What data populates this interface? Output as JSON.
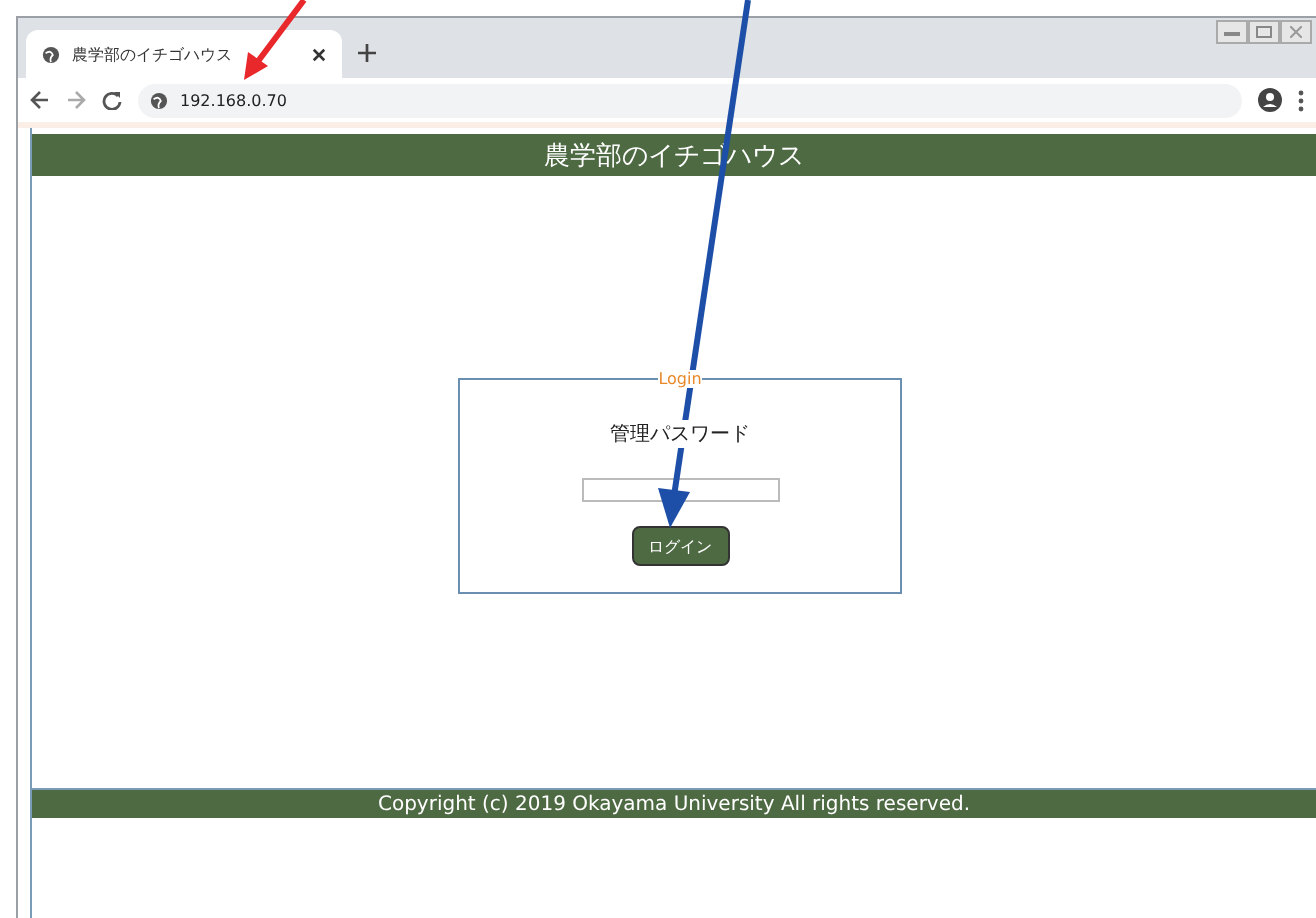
{
  "browser": {
    "tab": {
      "title": "農学部のイチゴハウス",
      "selected": true
    },
    "address": "192.168.0.70"
  },
  "page": {
    "header": "農学部のイチゴハウス",
    "login": {
      "legend": "Login",
      "label": "管理パスワード",
      "button": "ログイン"
    },
    "footer": "Copyright (c) 2019 Okayama University All rights reserved."
  }
}
